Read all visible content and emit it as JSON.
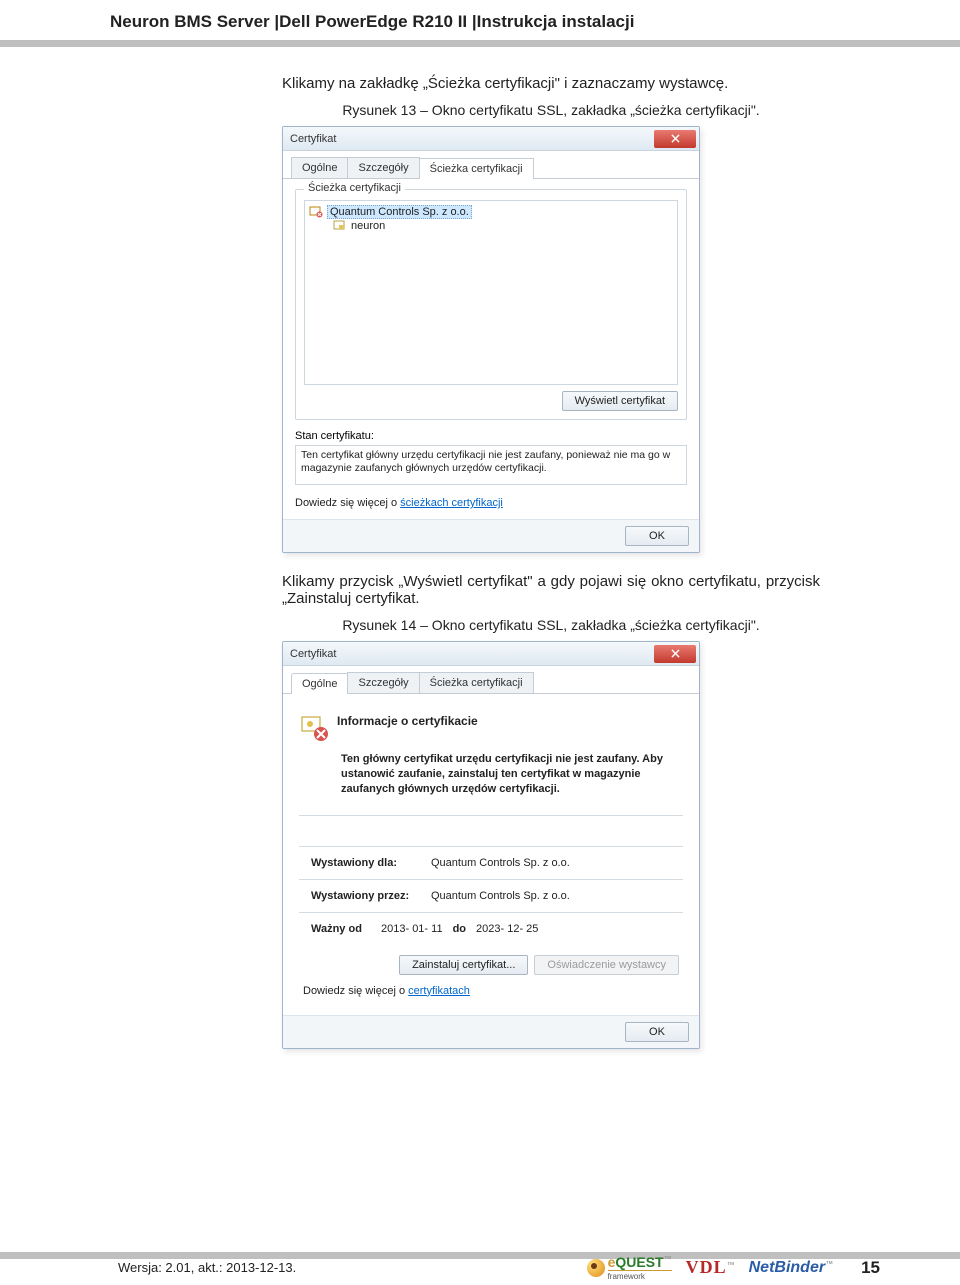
{
  "header": {
    "title": "Neuron BMS Server |Dell PowerEdge R210 II |Instrukcja instalacji"
  },
  "intro": "Klikamy na zakładkę „Ścieżka certyfikacji\" i zaznaczamy wystawcę.",
  "fig13_caption": "Rysunek 13 – Okno certyfikatu SSL, zakładka „ścieżka certyfikacji\".",
  "dlg1": {
    "title": "Certyfikat",
    "tab1": "Ogólne",
    "tab2": "Szczegóły",
    "tab3": "Ścieżka certyfikacji",
    "group_path": "Ścieżka certyfikacji",
    "tree_root": "Quantum Controls Sp. z o.o.",
    "tree_child": "neuron",
    "btn_view": "Wyświetl certyfikat",
    "status_label": "Stan certyfikatu:",
    "status_text": "Ten certyfikat główny urzędu certyfikacji nie jest zaufany, ponieważ nie ma go w magazynie zaufanych głównych urzędów certyfikacji.",
    "learn_prefix": "Dowiedz się więcej o ",
    "learn_link": "ścieżkach certyfikacji",
    "ok": "OK"
  },
  "mid_para": "Klikamy przycisk „Wyświetl certyfikat\" a gdy pojawi się okno certyfikatu, przycisk „Zainstaluj certyfikat.",
  "fig14_caption": "Rysunek 14 – Okno certyfikatu SSL, zakładka „ścieżka certyfikacji\".",
  "dlg2": {
    "title": "Certyfikat",
    "tab1": "Ogólne",
    "tab2": "Szczegóły",
    "tab3": "Ścieżka certyfikacji",
    "info_title": "Informacje o certyfikacie",
    "info_msg": "Ten główny certyfikat urzędu certyfikacji nie jest zaufany. Aby ustanowić zaufanie, zainstaluj ten certyfikat w magazynie zaufanych głównych urzędów certyfikacji.",
    "k_issued_to": "Wystawiony dla:",
    "v_issued_to": "Quantum Controls Sp. z o.o.",
    "k_issued_by": "Wystawiony przez:",
    "v_issued_by": "Quantum Controls Sp. z o.o.",
    "k_valid": "Ważny od",
    "v_valid_from": "2013- 01- 11",
    "v_valid_to_label": "do",
    "v_valid_to": "2023- 12- 25",
    "btn_install": "Zainstaluj certyfikat...",
    "btn_stmt": "Oświadczenie wystawcy",
    "learn_prefix": "Dowiedz się więcej o ",
    "learn_link": "certyfikatach",
    "ok": "OK"
  },
  "footer": {
    "version": "Wersja: 2.01, akt.: 2013-12-13.",
    "equest_e": "e",
    "equest_q": "QUEST",
    "equest_fw": "framework",
    "vdl": "VDL",
    "netbinder": "NetBinder",
    "page": "15"
  }
}
